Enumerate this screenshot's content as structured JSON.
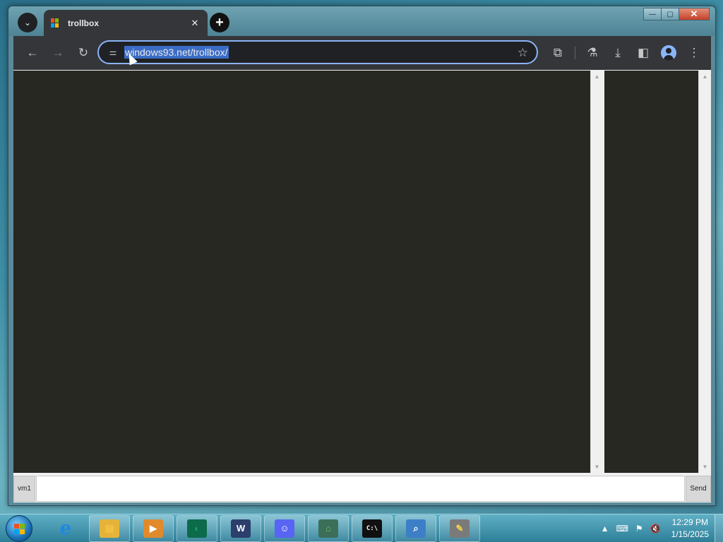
{
  "browser": {
    "tab": {
      "title": "trollbox",
      "close_glyph": "✕"
    },
    "new_tab_glyph": "+",
    "tab_search_glyph": "⌄",
    "window_controls": {
      "minimize": "—",
      "maximize": "▢",
      "close": "✕"
    },
    "toolbar": {
      "back_glyph": "←",
      "forward_glyph": "→",
      "reload_glyph": "↻",
      "site_info_glyph": "⚌",
      "url": "windows93.net/trollbox/",
      "bookmark_glyph": "☆",
      "extensions_glyph": "⧉",
      "labs_glyph": "⚗",
      "download_glyph": "⤓",
      "side_panel_glyph": "◧",
      "menu_glyph": "⋮"
    }
  },
  "trollbox": {
    "nick_button": "vm1",
    "message_placeholder": "",
    "send_button": "Send",
    "scroll_up": "▲",
    "scroll_down": "▼",
    "bg_color": "#272822"
  },
  "taskbar": {
    "apps": [
      {
        "name": "internet-explorer",
        "glyph": "e",
        "color": "#1e88e5",
        "bg": "transparent"
      },
      {
        "name": "file-explorer",
        "glyph": "▤",
        "color": "#f5c542",
        "bg": "#e6b33a"
      },
      {
        "name": "media-player",
        "glyph": "▶",
        "color": "#ffffff",
        "bg": "#e08a2c"
      },
      {
        "name": "browser-app",
        "glyph": "◐",
        "color": "#1f9c6e",
        "bg": "#0c6b4a"
      },
      {
        "name": "windows93-app",
        "glyph": "W",
        "color": "#ffffff",
        "bg": "#2c3e6b"
      },
      {
        "name": "discord",
        "glyph": "☺",
        "color": "#ffffff",
        "bg": "#5865f2"
      },
      {
        "name": "network-app",
        "glyph": "⌂",
        "color": "#6cc36a",
        "bg": "#3c6e5a"
      },
      {
        "name": "command-prompt",
        "glyph": "C:\\",
        "color": "#ffffff",
        "bg": "#111111"
      },
      {
        "name": "search-app",
        "glyph": "⌕",
        "color": "#ffffff",
        "bg": "#3d7fc7"
      },
      {
        "name": "paint-app",
        "glyph": "✎",
        "color": "#f3d34a",
        "bg": "#7a7a7a"
      }
    ],
    "tray": {
      "show_hidden_glyph": "▲",
      "network_glyph": "⌨",
      "flag_glyph": "⚑",
      "volume_glyph": "🔇",
      "time": "12:29 PM",
      "date": "1/15/2025"
    }
  }
}
